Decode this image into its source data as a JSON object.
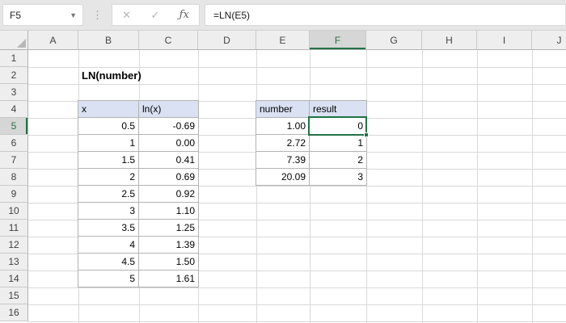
{
  "formula_bar": {
    "name_box": "F5",
    "formula": "=LN(E5)",
    "cancel_label": "✕",
    "enter_label": "✓",
    "fx_label": "ƒx"
  },
  "grid": {
    "columns": [
      "A",
      "B",
      "C",
      "D",
      "E",
      "F",
      "G",
      "H",
      "I",
      "J"
    ],
    "visible_rows": [
      "1",
      "2",
      "3",
      "4",
      "5",
      "6",
      "7",
      "8",
      "9",
      "10",
      "11",
      "12",
      "13",
      "14",
      "15",
      "16"
    ],
    "selected_cell": "F5",
    "selected_column": "F",
    "selected_row": "5"
  },
  "sheet": {
    "title": "LN(number)",
    "ln_table": {
      "headers": [
        "x",
        "ln(x)"
      ],
      "rows": [
        [
          "0.5",
          "-0.69"
        ],
        [
          "1",
          "0.00"
        ],
        [
          "1.5",
          "0.41"
        ],
        [
          "2",
          "0.69"
        ],
        [
          "2.5",
          "0.92"
        ],
        [
          "3",
          "1.10"
        ],
        [
          "3.5",
          "1.25"
        ],
        [
          "4",
          "1.39"
        ],
        [
          "4.5",
          "1.50"
        ],
        [
          "5",
          "1.61"
        ]
      ]
    },
    "example_table": {
      "headers": [
        "number",
        "result"
      ],
      "rows": [
        [
          "1.00",
          "0"
        ],
        [
          "2.72",
          "1"
        ],
        [
          "7.39",
          "2"
        ],
        [
          "20.09",
          "3"
        ]
      ]
    }
  },
  "colors": {
    "accent_green": "#217346",
    "table_header_fill": "#d9e1f2",
    "selected_header_fill": "#d6d6d6",
    "gridline": "#d9d9d9",
    "table_border": "#b3b3b3"
  }
}
